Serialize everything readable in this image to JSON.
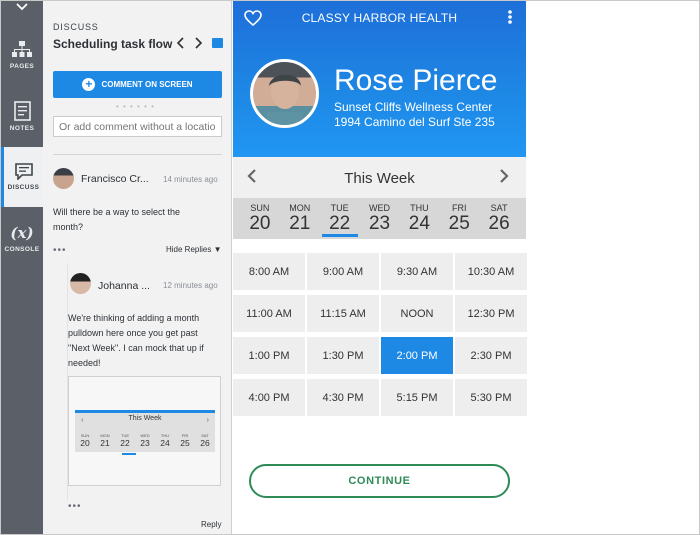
{
  "rail": {
    "items": [
      {
        "label": "PAGES",
        "icon": "sitemap-icon"
      },
      {
        "label": "NOTES",
        "icon": "notes-icon"
      },
      {
        "label": "DISCUSS",
        "icon": "discuss-icon"
      },
      {
        "label": "CONSOLE",
        "icon": "console-icon",
        "glyph": "(x)"
      }
    ],
    "active": "DISCUSS"
  },
  "discuss": {
    "eyebrow": "DISCUSS",
    "title": "Scheduling task flow",
    "comment_button": "COMMENT ON SCREEN",
    "comment_placeholder": "Or add comment without a location",
    "hide_replies": "Hide Replies ▼",
    "reply": "Reply",
    "thread": {
      "author": "Francisco Cr...",
      "time": "14 minutes ago",
      "text": "Will there be a way to select the month?"
    },
    "reply_comment": {
      "author": "Johanna ...",
      "time": "12 minutes ago",
      "text": "We're thinking of adding a month pulldown here once you get past \"Next Week\". I can mock that up if needed!"
    },
    "thumbnail": {
      "week": "This Week",
      "days": [
        {
          "name": "SUN",
          "date": "20"
        },
        {
          "name": "MON",
          "date": "21"
        },
        {
          "name": "TUE",
          "date": "22"
        },
        {
          "name": "WED",
          "date": "23"
        },
        {
          "name": "THU",
          "date": "24"
        },
        {
          "name": "FRI",
          "date": "25"
        },
        {
          "name": "SAT",
          "date": "26"
        }
      ]
    }
  },
  "app": {
    "brand": "CLASSY HARBOR HEALTH",
    "doctor": "Rose Pierce",
    "clinic": "Sunset Cliffs Wellness Center",
    "address": "1994 Camino del Surf Ste 235",
    "week_title": "This Week",
    "days": [
      {
        "name": "SUN",
        "date": "20"
      },
      {
        "name": "MON",
        "date": "21"
      },
      {
        "name": "TUE",
        "date": "22"
      },
      {
        "name": "WED",
        "date": "23"
      },
      {
        "name": "THU",
        "date": "24"
      },
      {
        "name": "FRI",
        "date": "25"
      },
      {
        "name": "SAT",
        "date": "26"
      }
    ],
    "selected_day": "TUE",
    "slots": [
      "8:00 AM",
      "9:00 AM",
      "9:30 AM",
      "10:30 AM",
      "11:00 AM",
      "11:15 AM",
      "NOON",
      "12:30 PM",
      "1:00 PM",
      "1:30 PM",
      "2:00 PM",
      "2:30 PM",
      "4:00 PM",
      "4:30 PM",
      "5:15 PM",
      "5:30 PM"
    ],
    "selected_slot": "2:00 PM",
    "continue": "CONTINUE"
  },
  "colors": {
    "accent": "#1e88e5",
    "rail": "#5b6068",
    "continue": "#2e8b57"
  }
}
